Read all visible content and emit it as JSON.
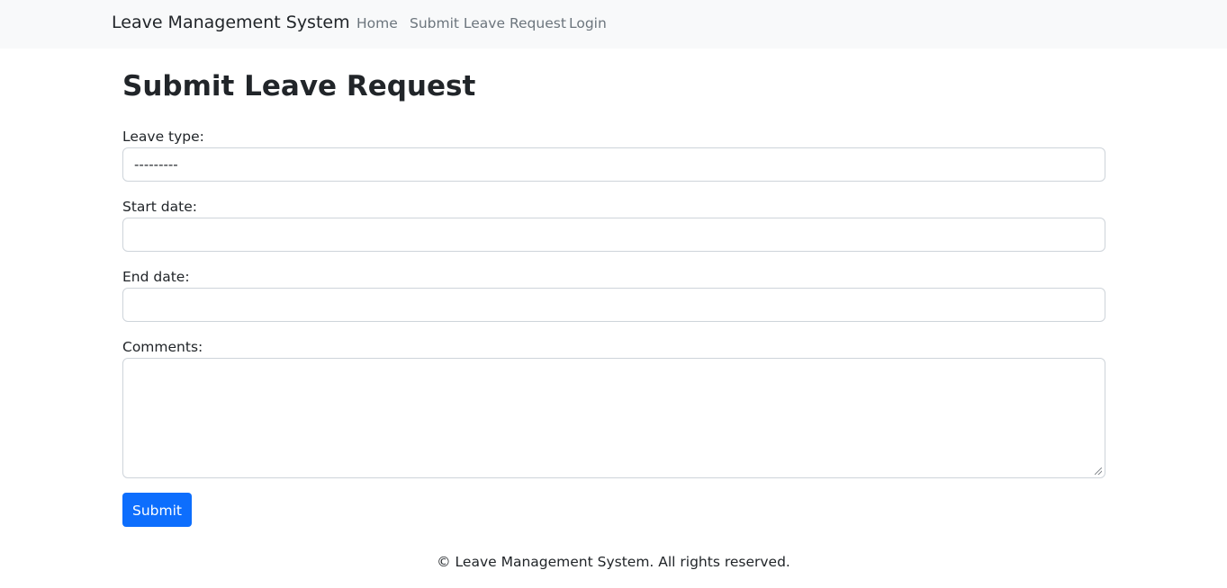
{
  "navbar": {
    "brand": "Leave Management System",
    "links": [
      {
        "label": "Home"
      },
      {
        "label": "Submit Leave Request"
      },
      {
        "label": "Login"
      }
    ]
  },
  "page": {
    "title": "Submit Leave Request"
  },
  "form": {
    "leave_type": {
      "label": "Leave type:",
      "value": "---------"
    },
    "start_date": {
      "label": "Start date:",
      "value": ""
    },
    "end_date": {
      "label": "End date:",
      "value": ""
    },
    "comments": {
      "label": "Comments:",
      "value": ""
    },
    "submit_label": "Submit"
  },
  "footer": {
    "text": "© Leave Management System. All rights reserved."
  },
  "colors": {
    "navbar_bg": "#f8f9fa",
    "primary": "#0d6efd",
    "nav_link": "#6c757d",
    "border": "#ced4da"
  }
}
